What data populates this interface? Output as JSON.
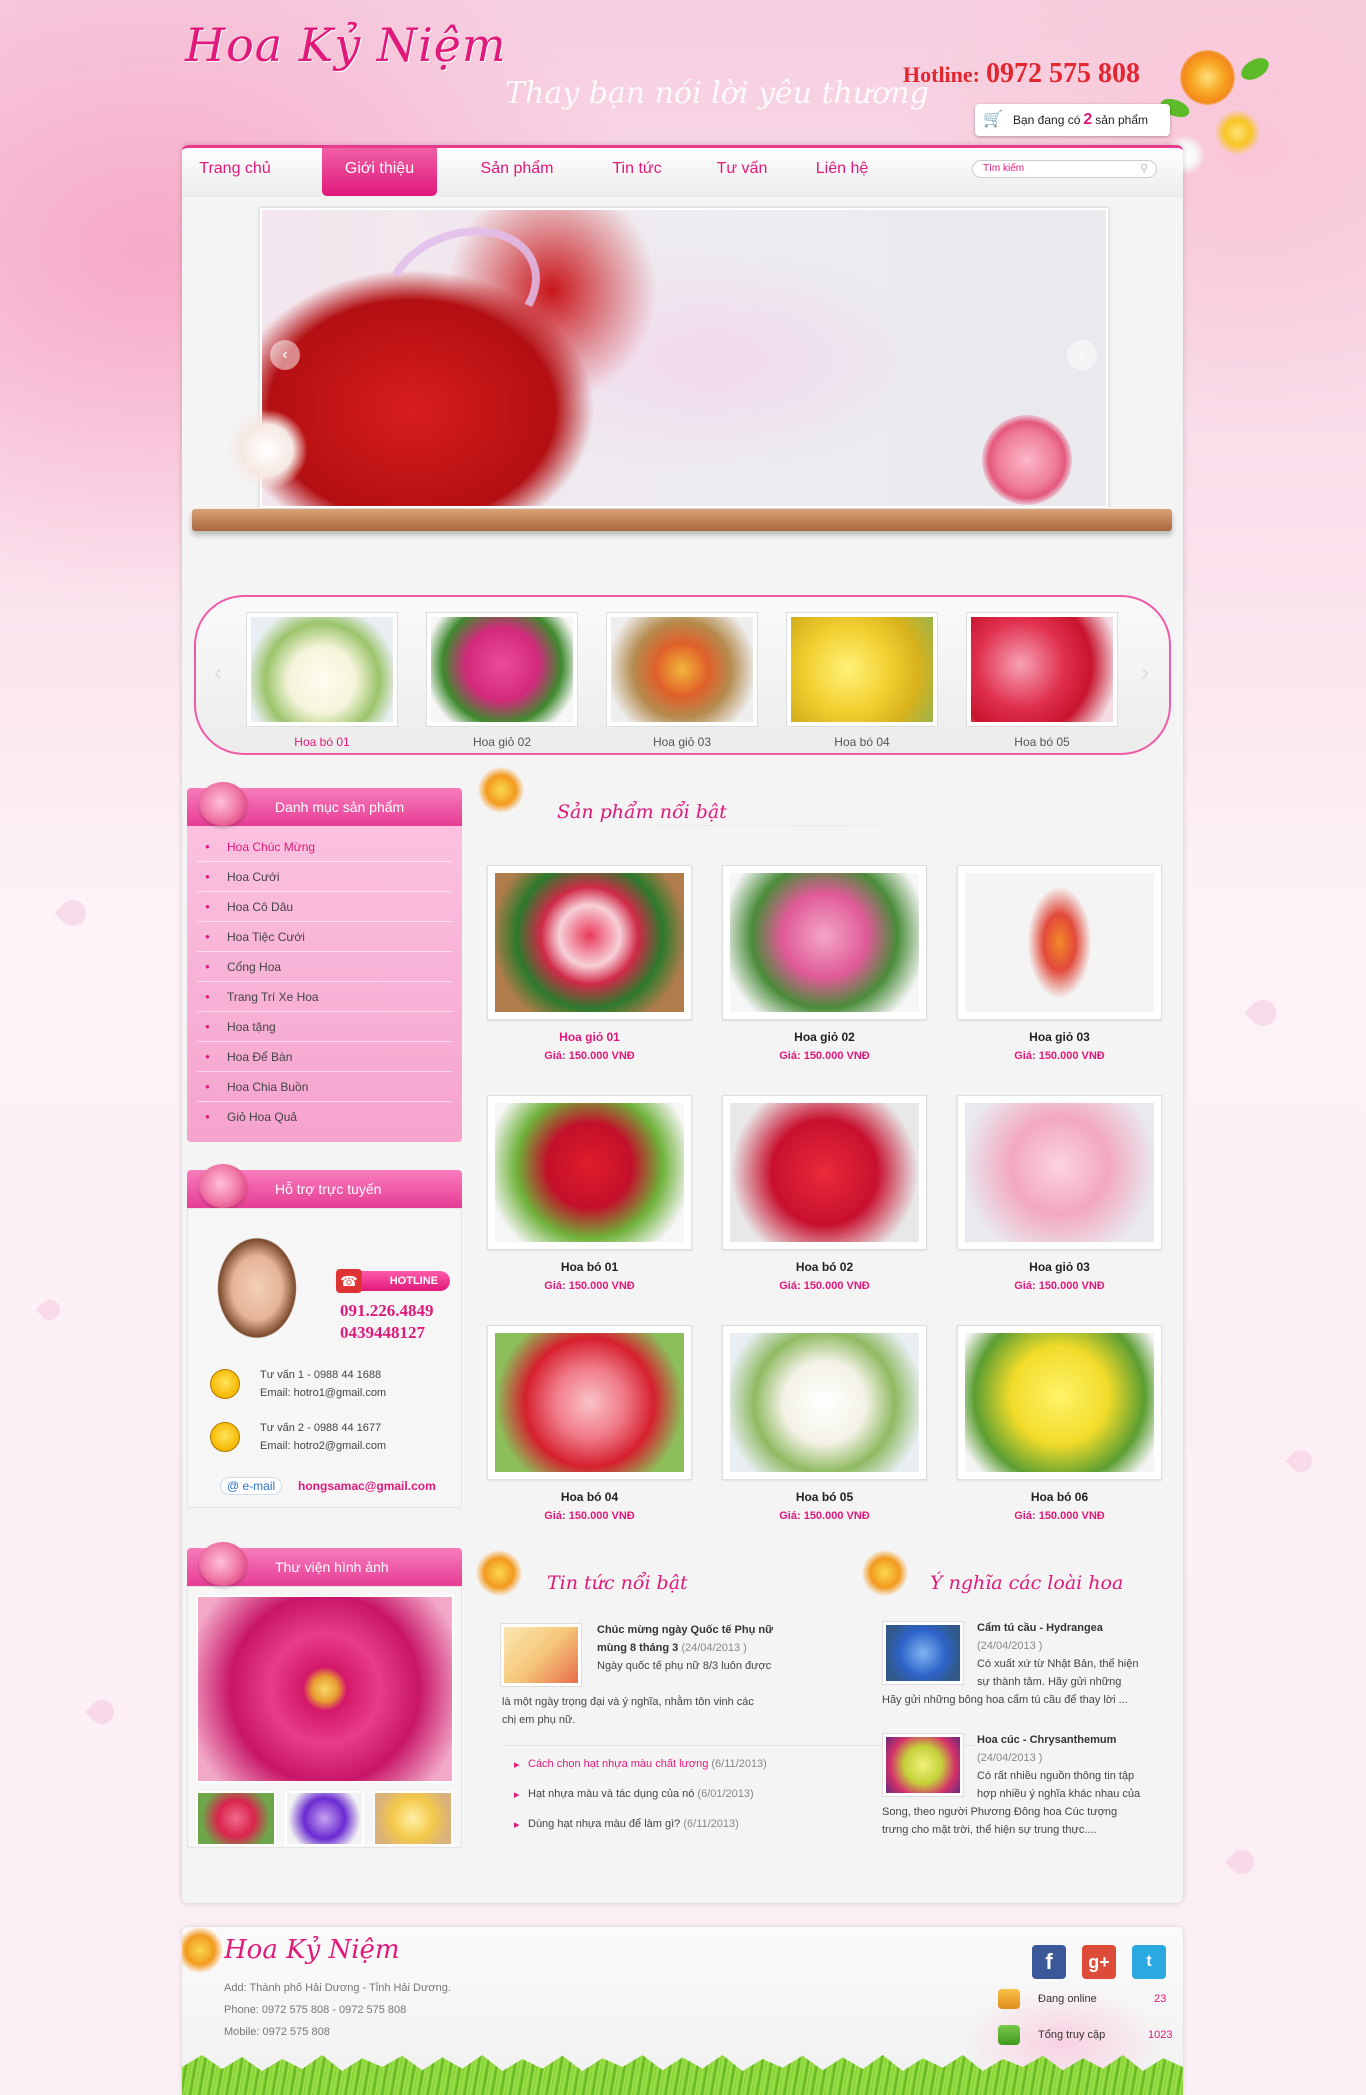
{
  "header": {
    "logo": "Hoa Kỷ Niệm",
    "slogan": "Thay bạn nói lời yêu thương",
    "hotline_label": "Hotline:",
    "hotline_number": "0972 575 808",
    "cart_prefix": "Bạn đang có",
    "cart_count": "2",
    "cart_suffix": "sản phẩm"
  },
  "nav": {
    "items": [
      "Trang chủ",
      "Giới thiệu",
      "Sản phẩm",
      "Tin tức",
      "Tư vấn",
      "Liên hệ"
    ],
    "active": "Giới thiệu",
    "search_placeholder": "Tìm kiếm"
  },
  "carousel": {
    "items": [
      "Hoa bó 01",
      "Hoa giỏ 02",
      "Hoa giỏ 03",
      "Hoa bó 04",
      "Hoa bó 05"
    ]
  },
  "categories": {
    "title": "Danh mục sản phẩm",
    "items": [
      "Hoa Chúc Mừng",
      "Hoa Cưới",
      "Hoa Cô Dâu",
      "Hoa Tiệc Cưới",
      "Cổng Hoa",
      "Trang Trí Xe Hoa",
      "Hoa tặng",
      "Hoa Để Bàn",
      "Hoa Chia Buồn",
      "Giỏ Hoa Quả"
    ]
  },
  "support": {
    "title": "Hỗ trợ trực tuyến",
    "hotline_tag": "HOTLINE",
    "phone1": "091.226.4849",
    "phone2": "0439448127",
    "advisor1": "Tư vấn 1 - 0988 44 1688",
    "email1": "Email: hotro1@gmail.com",
    "advisor2": "Tư vấn 2 - 0988 44 1677",
    "email2": "Email: hotro2@gmail.com",
    "email_badge": "@ e-mail",
    "email_main": "hongsamac@gmail.com"
  },
  "gallery": {
    "title": "Thư viện hình ảnh"
  },
  "featured": {
    "title": "Sản phẩm nổi bật",
    "products": [
      {
        "name": "Hoa giỏ 01",
        "price": "Giá: 150.000 VNĐ"
      },
      {
        "name": "Hoa giỏ 02",
        "price": "Giá: 150.000 VNĐ"
      },
      {
        "name": "Hoa giỏ 03",
        "price": "Giá: 150.000 VNĐ"
      },
      {
        "name": "Hoa bó 01",
        "price": "Giá: 150.000 VNĐ"
      },
      {
        "name": "Hoa bó 02",
        "price": "Giá: 150.000 VNĐ"
      },
      {
        "name": "Hoa giỏ 03",
        "price": "Giá: 150.000 VNĐ"
      },
      {
        "name": "Hoa bó 04",
        "price": "Giá: 150.000 VNĐ"
      },
      {
        "name": "Hoa bó 05",
        "price": "Giá: 150.000 VNĐ"
      },
      {
        "name": "Hoa bó 06",
        "price": "Giá: 150.000 VNĐ"
      }
    ]
  },
  "news": {
    "title": "Tin tức nổi bật",
    "main_title_1": "Chúc mừng ngày Quốc tế Phụ nữ",
    "main_title_2": "mùng 8 tháng 3",
    "main_date": "(24/04/2013 )",
    "main_excerpt_1": "Ngày quốc tế phụ nữ 8/3 luôn được",
    "main_excerpt_2": "là một ngày trọng đại và ý nghĩa, nhằm tôn vinh các",
    "main_excerpt_3": "chị em phụ nữ.",
    "links": [
      {
        "text": "Cách chọn hạt nhựa màu chất lượng",
        "date": "(6/11/2013)"
      },
      {
        "text": "Hạt nhựa màu và tác dụng của nó",
        "date": "(6/01/2013)"
      },
      {
        "text": "Dùng hạt nhựa màu để làm gì?",
        "date": "(6/11/2013)"
      }
    ]
  },
  "meaning": {
    "title": "Ý nghĩa các loài hoa",
    "items": [
      {
        "title": "Cẩm tú cầu - Hydrangea",
        "date": "(24/04/2013 )",
        "line1": "Có xuất xứ từ Nhật Bản, thể hiện",
        "line2": "sự thành tâm. Hãy gửi những",
        "line3": "Hãy gửi những bông hoa cẩm tú cầu để thay lời ..."
      },
      {
        "title": "Hoa cúc - Chrysanthemum",
        "date": "(24/04/2013 )",
        "line1": "Có rất nhiều nguồn thông tin tập",
        "line2": "hợp nhiều ý nghĩa khác nhau của",
        "line3": "Song, theo người Phương Đông hoa Cúc tượng",
        "line4": "trưng cho mặt trời, thể hiện sự trung thực...."
      }
    ]
  },
  "footer": {
    "logo": "Hoa Kỷ Niệm",
    "address": "Add: Thành phố Hải Dương - Tỉnh Hải Dương.",
    "phone": "Phone: 0972 575 808 - 0972 575 808",
    "mobile": "Mobile: 0972 575 808",
    "online_label": "Đang online",
    "online_value": "23",
    "total_label": "Tổng truy cập",
    "total_value": "1023",
    "social": [
      "facebook-icon",
      "google-plus-icon",
      "twitter-icon"
    ]
  },
  "colors": {
    "brand": "#e0197a",
    "hotline": "#e3262f",
    "background": "#fbe3ee"
  }
}
